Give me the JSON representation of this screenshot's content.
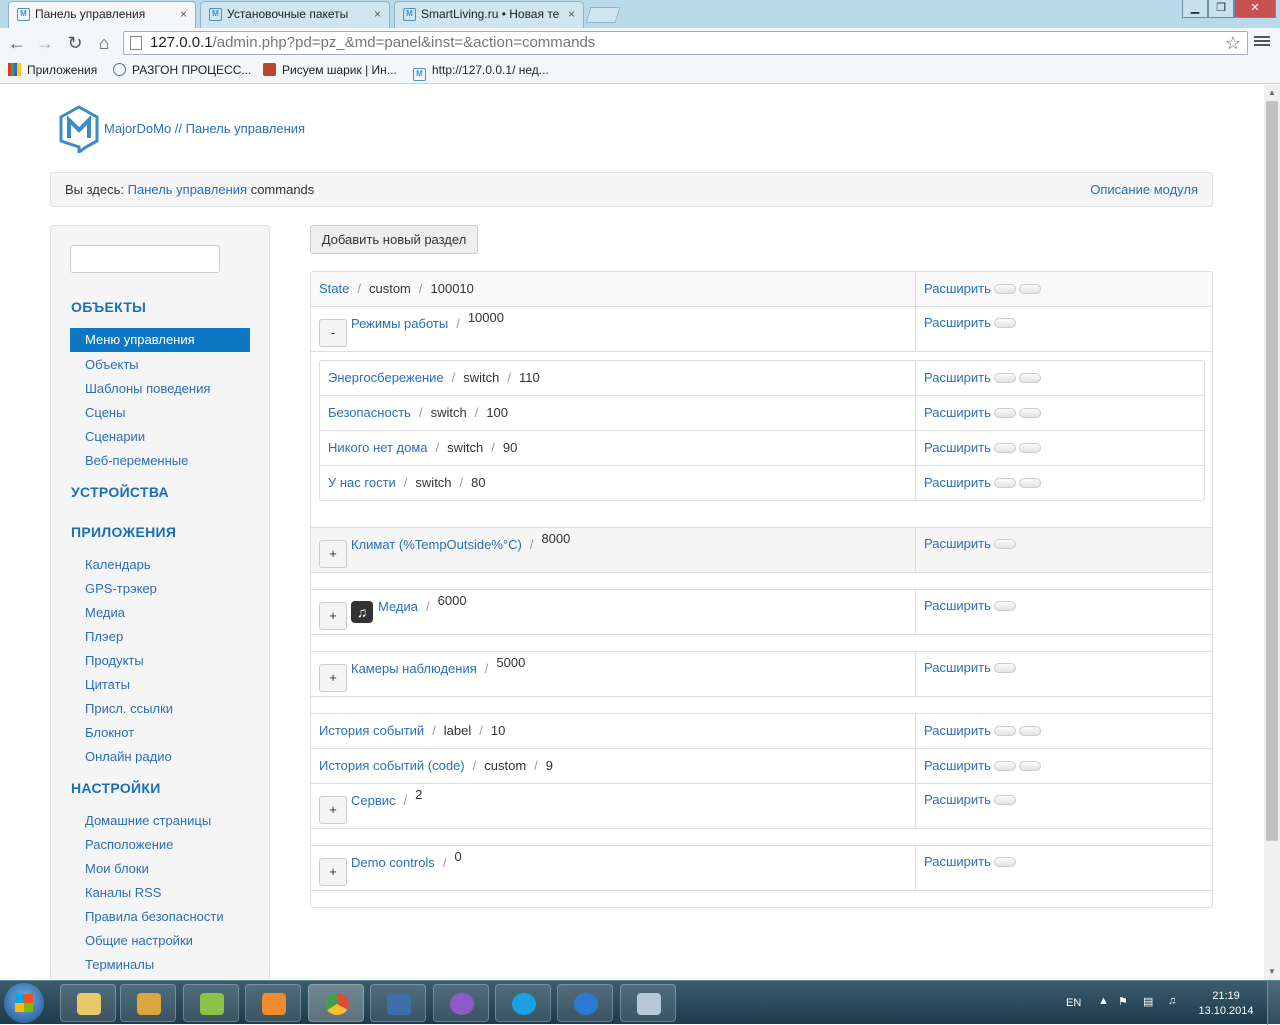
{
  "browser": {
    "tabs": [
      {
        "label": "Панель управления",
        "active": true
      },
      {
        "label": "Установочные пакеты",
        "active": false
      },
      {
        "label": "SmartLiving.ru • Новая те",
        "active": false
      }
    ],
    "close_glyph": "×",
    "window_buttons": [
      "▁",
      "❐",
      "✕"
    ],
    "url_host": "127.0.0.1",
    "url_path": "/admin.php?pd=pz_&md=panel&inst=&action=commands",
    "bookmarks": [
      {
        "label": "Приложения",
        "icon": "apps-grid-icon"
      },
      {
        "label": "РАЗГОН ПРОЦЕСС...",
        "icon": "globe-icon"
      },
      {
        "label": "Рисуем шарик | Ин...",
        "icon": "picture-icon"
      },
      {
        "label": "http://127.0.0.1/ нед...",
        "icon": "majordomo-favicon"
      }
    ]
  },
  "header": {
    "brand": "MajorDoMo // Панель управления"
  },
  "breadcrumb": {
    "prefix": "Вы здесь:",
    "link": "Панель управления",
    "current": "commands",
    "module_desc": "Описание модуля"
  },
  "sidebar": {
    "sections": [
      {
        "title": "ОБЪЕКТЫ",
        "items": [
          "Меню управления",
          "Объекты",
          "Шаблоны поведения",
          "Сцены",
          "Сценарии",
          "Веб-переменные"
        ]
      },
      {
        "title": "УСТРОЙСТВА",
        "items": []
      },
      {
        "title": "ПРИЛОЖЕНИЯ",
        "items": [
          "Календарь",
          "GPS-трэкер",
          "Медиа",
          "Плэер",
          "Продукты",
          "Цитаты",
          "Присл. ссылки",
          "Блокнот",
          "Онлайн радио"
        ]
      },
      {
        "title": "НАСТРОЙКИ",
        "items": [
          "Домашние страницы",
          "Расположение",
          "Мои блоки",
          "Каналы RSS",
          "Правила безопасности",
          "Общие настройки",
          "Терминалы"
        ]
      }
    ],
    "active_item": "Меню управления"
  },
  "main": {
    "add_button": "Добавить новый раздел",
    "expand_label": "Расширить",
    "sep": "/",
    "rows": [
      {
        "title": "State",
        "type": "custom",
        "priority": "100010"
      },
      {
        "toggle": "-",
        "title": "Режимы работы",
        "priority": "10000"
      },
      {
        "toggle": "+",
        "title": "Климат (%TempOutside%°C)",
        "priority": "8000"
      },
      {
        "toggle": "+",
        "title": "Медиа",
        "priority": "6000",
        "icon": "music-note-icon",
        "icon_glyph": "♫"
      },
      {
        "toggle": "+",
        "title": "Камеры наблюдения",
        "priority": "5000"
      },
      {
        "title": "История событий",
        "type": "label",
        "priority": "10"
      },
      {
        "title": "История событий (code)",
        "type": "custom",
        "priority": "9"
      },
      {
        "toggle": "+",
        "title": "Сервис",
        "priority": "2"
      },
      {
        "toggle": "+",
        "title": "Demo controls",
        "priority": "0"
      }
    ],
    "subrows": [
      {
        "title": "Энергосбережение",
        "type": "switch",
        "priority": "110"
      },
      {
        "title": "Безопасность",
        "type": "switch",
        "priority": "100"
      },
      {
        "title": "Никого нет дома",
        "type": "switch",
        "priority": "90"
      },
      {
        "title": "У нас гости",
        "type": "switch",
        "priority": "80"
      }
    ]
  },
  "taskbar": {
    "lang": "EN",
    "time": "21:19",
    "date": "13.10.2014",
    "app_colors": [
      "#e8c86a",
      "#d9a640",
      "#8bc34a",
      "#f08c2e",
      "#dd4b39",
      "#3d6ea8",
      "#8e5bc9",
      "#1ba1e2",
      "#2c7ad6",
      "#b7c7d6"
    ]
  },
  "colors": {
    "accent": "#0e77c4",
    "link": "#2a6ebb"
  }
}
